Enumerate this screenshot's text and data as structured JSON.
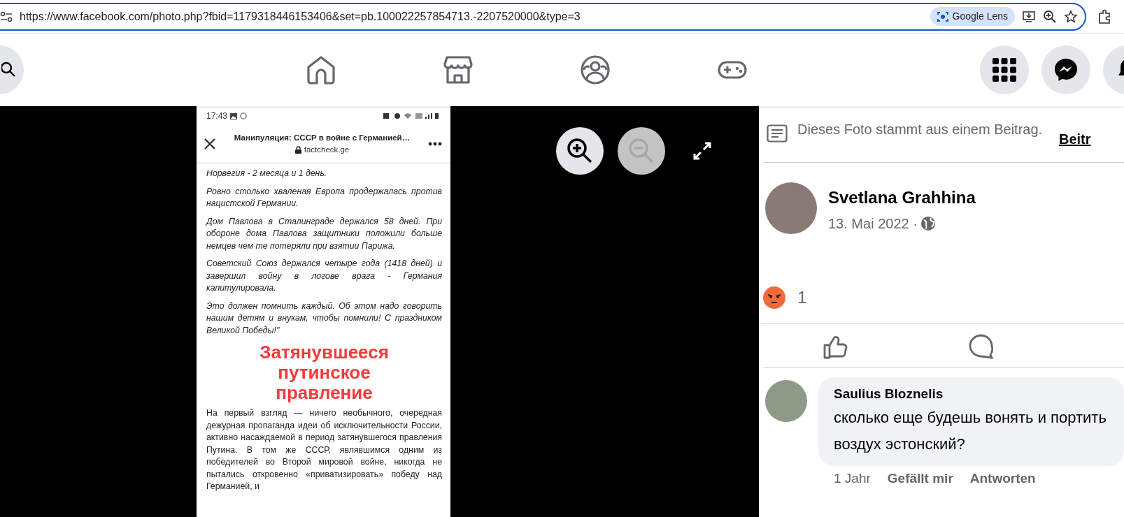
{
  "browser": {
    "url": "https://www.facebook.com/photo.php?fbid=1179318446153406&set=pb.100022257854713.-2207520000&type=3",
    "lens_label": "Google Lens"
  },
  "photo_viewer": {
    "controls": [
      {
        "kind": "zoom_in",
        "disabled": false
      },
      {
        "kind": "zoom_out",
        "disabled": true
      },
      {
        "kind": "fullscreen",
        "disabled": false
      }
    ],
    "screenshot": {
      "time": "17:43",
      "title": "Манипуляция: СССР в войне с Германией…",
      "domain": "factcheck.ge",
      "paragraphs": [
        {
          "kind": "quote",
          "text": "Норвегия - 2 месяца и 1 день."
        },
        {
          "kind": "quote",
          "text": "Ровно столько хваленая Европа продержалась против нацистской Германии."
        },
        {
          "kind": "quote",
          "text": "Дом Павлова в Сталинграде держался 58 дней. При обороне дома Павлова защитники положили больше немцев чем те потеряли при взятии Парижа."
        },
        {
          "kind": "quote",
          "text": "Советский Союз держался четыре года (1418 дней) и завершил войну в логове врага - Германия капитулировала."
        },
        {
          "kind": "quote",
          "text": "Это должен помнить каждый. Об этом надо говорить нашим детям и внукам, чтобы помнили! С праздником Великой Победы!\""
        },
        {
          "kind": "caption",
          "lines": [
            "Затянувшееся",
            "путинское",
            "правление"
          ]
        },
        {
          "kind": "body",
          "text": "На первый взгляд — ничего необычного, очередная дежурная пропаганда идеи об исключительности России, активно насаждаемой в период затянувшегося правления Путина. В том же СССР, являвшимся одним из победителей во Второй мировой войне, никогда не пытались откровенно «приватизировать» победу над Германией, и"
        }
      ]
    }
  },
  "post": {
    "notice": "Dieses Foto stammt aus einem Beitrag.",
    "notice_link": "Beitr",
    "author": "Svetlana Grahhina",
    "date": "13. Mai 2022 ·",
    "reaction_count": "1"
  },
  "comments": [
    {
      "author": "Saulius Bloznelis",
      "text": "сколько еще будешь вонять и портить воздух эстонский?",
      "time": "1 Jahr",
      "like": "Gefällt mir",
      "reply": "Antworten"
    }
  ]
}
